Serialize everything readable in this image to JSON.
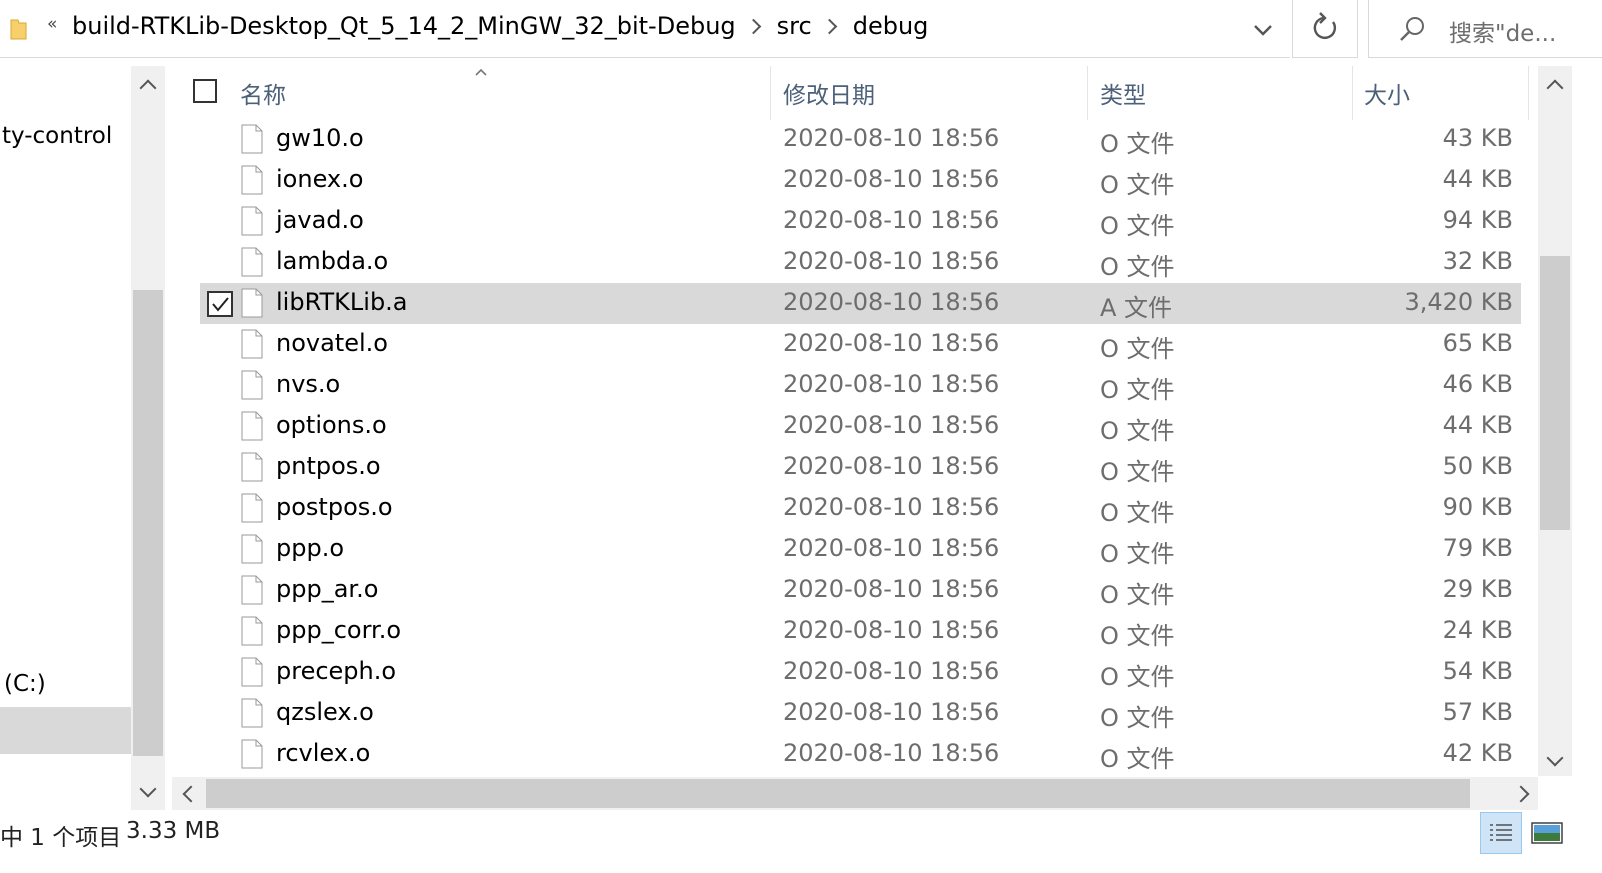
{
  "address_bar": {
    "overflow": "«",
    "crumbs": [
      "build-RTKLib-Desktop_Qt_5_14_2_MinGW_32_bit-Debug",
      "src",
      "debug"
    ],
    "search_placeholder": "搜索\"de..."
  },
  "nav_pane": {
    "items": [
      "ty-control",
      "(C:)"
    ]
  },
  "columns": {
    "name": "名称",
    "date": "修改日期",
    "type": "类型",
    "size": "大小"
  },
  "files": [
    {
      "name": "gw10.o",
      "date": "2020-08-10 18:56",
      "type": "O 文件",
      "size": "43 KB",
      "selected": false
    },
    {
      "name": "ionex.o",
      "date": "2020-08-10 18:56",
      "type": "O 文件",
      "size": "44 KB",
      "selected": false
    },
    {
      "name": "javad.o",
      "date": "2020-08-10 18:56",
      "type": "O 文件",
      "size": "94 KB",
      "selected": false
    },
    {
      "name": "lambda.o",
      "date": "2020-08-10 18:56",
      "type": "O 文件",
      "size": "32 KB",
      "selected": false
    },
    {
      "name": "libRTKLib.a",
      "date": "2020-08-10 18:56",
      "type": "A 文件",
      "size": "3,420 KB",
      "selected": true
    },
    {
      "name": "novatel.o",
      "date": "2020-08-10 18:56",
      "type": "O 文件",
      "size": "65 KB",
      "selected": false
    },
    {
      "name": "nvs.o",
      "date": "2020-08-10 18:56",
      "type": "O 文件",
      "size": "46 KB",
      "selected": false
    },
    {
      "name": "options.o",
      "date": "2020-08-10 18:56",
      "type": "O 文件",
      "size": "44 KB",
      "selected": false
    },
    {
      "name": "pntpos.o",
      "date": "2020-08-10 18:56",
      "type": "O 文件",
      "size": "50 KB",
      "selected": false
    },
    {
      "name": "postpos.o",
      "date": "2020-08-10 18:56",
      "type": "O 文件",
      "size": "90 KB",
      "selected": false
    },
    {
      "name": "ppp.o",
      "date": "2020-08-10 18:56",
      "type": "O 文件",
      "size": "79 KB",
      "selected": false
    },
    {
      "name": "ppp_ar.o",
      "date": "2020-08-10 18:56",
      "type": "O 文件",
      "size": "29 KB",
      "selected": false
    },
    {
      "name": "ppp_corr.o",
      "date": "2020-08-10 18:56",
      "type": "O 文件",
      "size": "24 KB",
      "selected": false
    },
    {
      "name": "preceph.o",
      "date": "2020-08-10 18:56",
      "type": "O 文件",
      "size": "54 KB",
      "selected": false
    },
    {
      "name": "qzslex.o",
      "date": "2020-08-10 18:56",
      "type": "O 文件",
      "size": "57 KB",
      "selected": false
    },
    {
      "name": "rcvlex.o",
      "date": "2020-08-10 18:56",
      "type": "O 文件",
      "size": "42 KB",
      "selected": false
    }
  ],
  "status_bar": {
    "selection_count": "中 1 个项目",
    "selection_size": "3.33 MB"
  },
  "colors": {
    "selected_row": "#d9d9d9",
    "header_text": "#4c607a",
    "secondary_text": "#6d6d6d",
    "scrollbar_track": "#f0f0f0",
    "scrollbar_thumb": "#cdcdcd"
  }
}
